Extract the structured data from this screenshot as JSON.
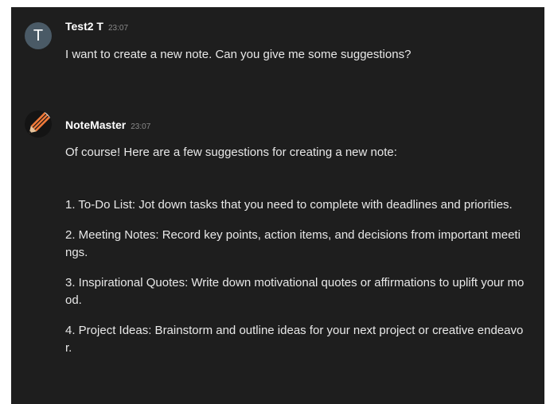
{
  "messages": [
    {
      "user": "Test2 T",
      "avatar_letter": "T",
      "time": "23:07",
      "text": "I want to create a new note. Can you give me some suggestions?"
    },
    {
      "user": "NoteMaster",
      "avatar_icon": "pencil-logo-icon",
      "time": "23:07",
      "paragraphs": [
        "Of course! Here are a few suggestions for creating a new note:",
        "1. To-Do List: Jot down tasks that you need to complete with deadlines and priorities.",
        "2. Meeting Notes: Record key points, action items, and decisions from important meetings.",
        "3. Inspirational Quotes: Write down motivational quotes or affirmations to uplift your mood.",
        "4. Project Ideas: Brainstorm and outline ideas for your next project or creative endeavor."
      ]
    }
  ],
  "colors": {
    "background": "#1e1e1e",
    "text": "#e8e8e8",
    "avatar_user": "#4a5a66",
    "avatar_bot_orange": "#f07a3a"
  }
}
